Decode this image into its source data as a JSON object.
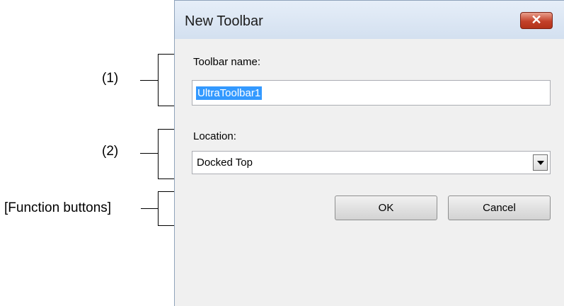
{
  "annotations": {
    "item1": "(1)",
    "item2": "(2)",
    "function_buttons": "[Function buttons]"
  },
  "dialog": {
    "title": "New Toolbar",
    "close_glyph": "✕",
    "toolbar_name_label": "Toolbar name:",
    "toolbar_name_value": "UltraToolbar1",
    "location_label": "Location:",
    "location_value": "Docked Top",
    "ok_label": "OK",
    "cancel_label": "Cancel"
  },
  "colors": {
    "selection": "#3399ff",
    "close_button": "#c3412a"
  }
}
